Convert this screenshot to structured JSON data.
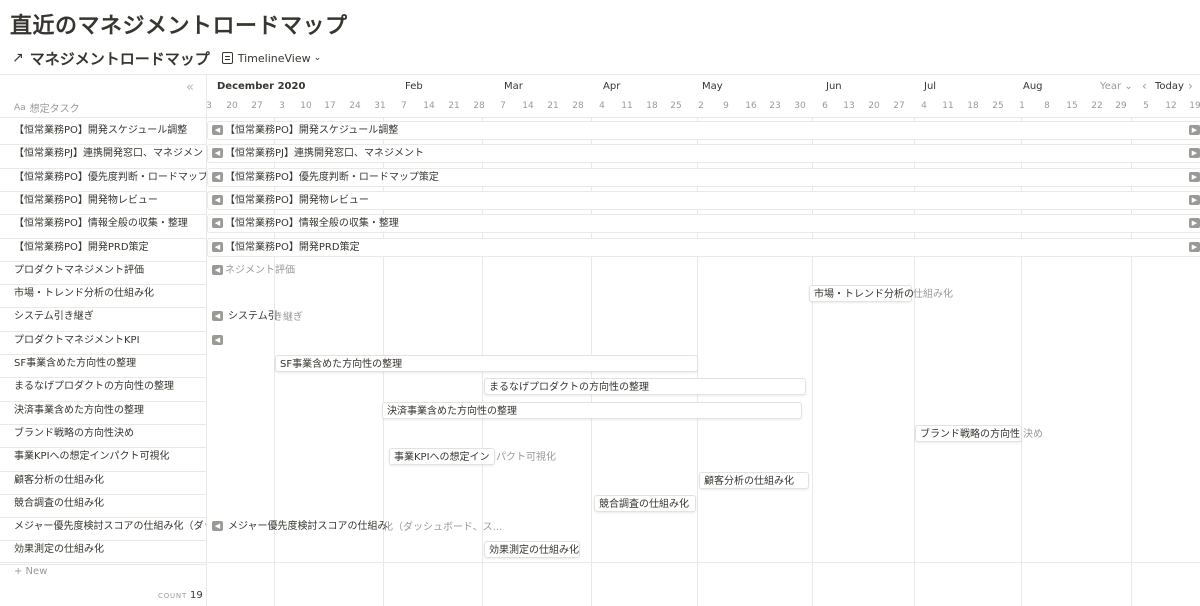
{
  "page": {
    "title": "直近のマネジメントロードマップ"
  },
  "view": {
    "database_title": "マネジメントロードマップ",
    "view_name": "TimelineView",
    "link_arrow": "↗"
  },
  "left": {
    "collapse": "«",
    "property_icon": "Aa",
    "property_header": "想定タスク",
    "new_label": "+ New",
    "count_label": "COUNT",
    "count_value": "19"
  },
  "timeline": {
    "months": [
      "December 2020",
      "Feb",
      "Mar",
      "Apr",
      "May",
      "Jun",
      "Jul",
      "Aug"
    ],
    "ticks": [
      "3",
      "20",
      "27",
      "3",
      "10",
      "17",
      "24",
      "31",
      "7",
      "14",
      "21",
      "28",
      "7",
      "14",
      "21",
      "28",
      "4",
      "11",
      "18",
      "25",
      "2",
      "9",
      "16",
      "23",
      "30",
      "6",
      "13",
      "20",
      "27",
      "4",
      "11",
      "18",
      "25",
      "1",
      "8",
      "15",
      "22",
      "29",
      "5",
      "12",
      "19"
    ],
    "scale": "Year",
    "prev": "‹",
    "today": "Today",
    "next": "›"
  },
  "rows": [
    {
      "label": "【恒常業務PO】開発スケジュール調整",
      "bar_text": "【恒常業務PO】開発スケジュール調整"
    },
    {
      "label": "【恒常業務PJ】連携開発窓口、マネジメント",
      "bar_text": "【恒常業務PJ】連携開発窓口、マネジメント"
    },
    {
      "label": "【恒常業務PO】優先度判断・ロードマップ策定",
      "bar_text": "【恒常業務PO】優先度判断・ロードマップ策定"
    },
    {
      "label": "【恒常業務PO】開発物レビュー",
      "bar_text": "【恒常業務PO】開発物レビュー"
    },
    {
      "label": "【恒常業務PO】情報全般の収集・整理",
      "bar_text": "【恒常業務PO】情報全般の収集・整理"
    },
    {
      "label": "【恒常業務PO】開発PRD策定",
      "bar_text": "【恒常業務PO】開発PRD策定"
    },
    {
      "label": "プロダクトマネジメント評価",
      "bar_text": "ネジメント評価"
    },
    {
      "label": "市場・トレンド分析の仕組み化",
      "bar_text": "市場・トレンド分析の",
      "bar_ext": "仕組み化"
    },
    {
      "label": "システム引き継ぎ",
      "bar_text": "システム引",
      "bar_ext": "き継ぎ"
    },
    {
      "label": "プロダクトマネジメントKPI",
      "bar_text": ""
    },
    {
      "label": "SF事業含めた方向性の整理",
      "bar_text": "SF事業含めた方向性の整理"
    },
    {
      "label": "まるなげプロダクトの方向性の整理",
      "bar_text": "まるなげプロダクトの方向性の整理"
    },
    {
      "label": "決済事業含めた方向性の整理",
      "bar_text": "決済事業含めた方向性の整理"
    },
    {
      "label": "ブランド戦略の方向性決め",
      "bar_text": "ブランド戦略の方向性",
      "bar_ext": "決め"
    },
    {
      "label": "事業KPIへの想定インパクト可視化",
      "bar_text": "事業KPIへの想定イン",
      "bar_ext": "パクト可視化"
    },
    {
      "label": "顧客分析の仕組み化",
      "bar_text": "顧客分析の仕組み化"
    },
    {
      "label": "競合調査の仕組み化",
      "bar_text": "競合調査の仕組み化"
    },
    {
      "label": "メジャー優先度検討スコアの仕組み化（ダッシュボード、スコアリング）",
      "bar_text": "メジャー優先度検討スコアの仕組み",
      "bar_ext": "化（ダッシュボード、ス..."
    },
    {
      "label": "効果測定の仕組み化",
      "bar_text": "効果測定の仕組み化"
    }
  ],
  "colors": {
    "text": "#37352f",
    "muted": "#9b9a97",
    "grid": "#e9e9e7",
    "arrow_bg": "#9b9a97"
  }
}
